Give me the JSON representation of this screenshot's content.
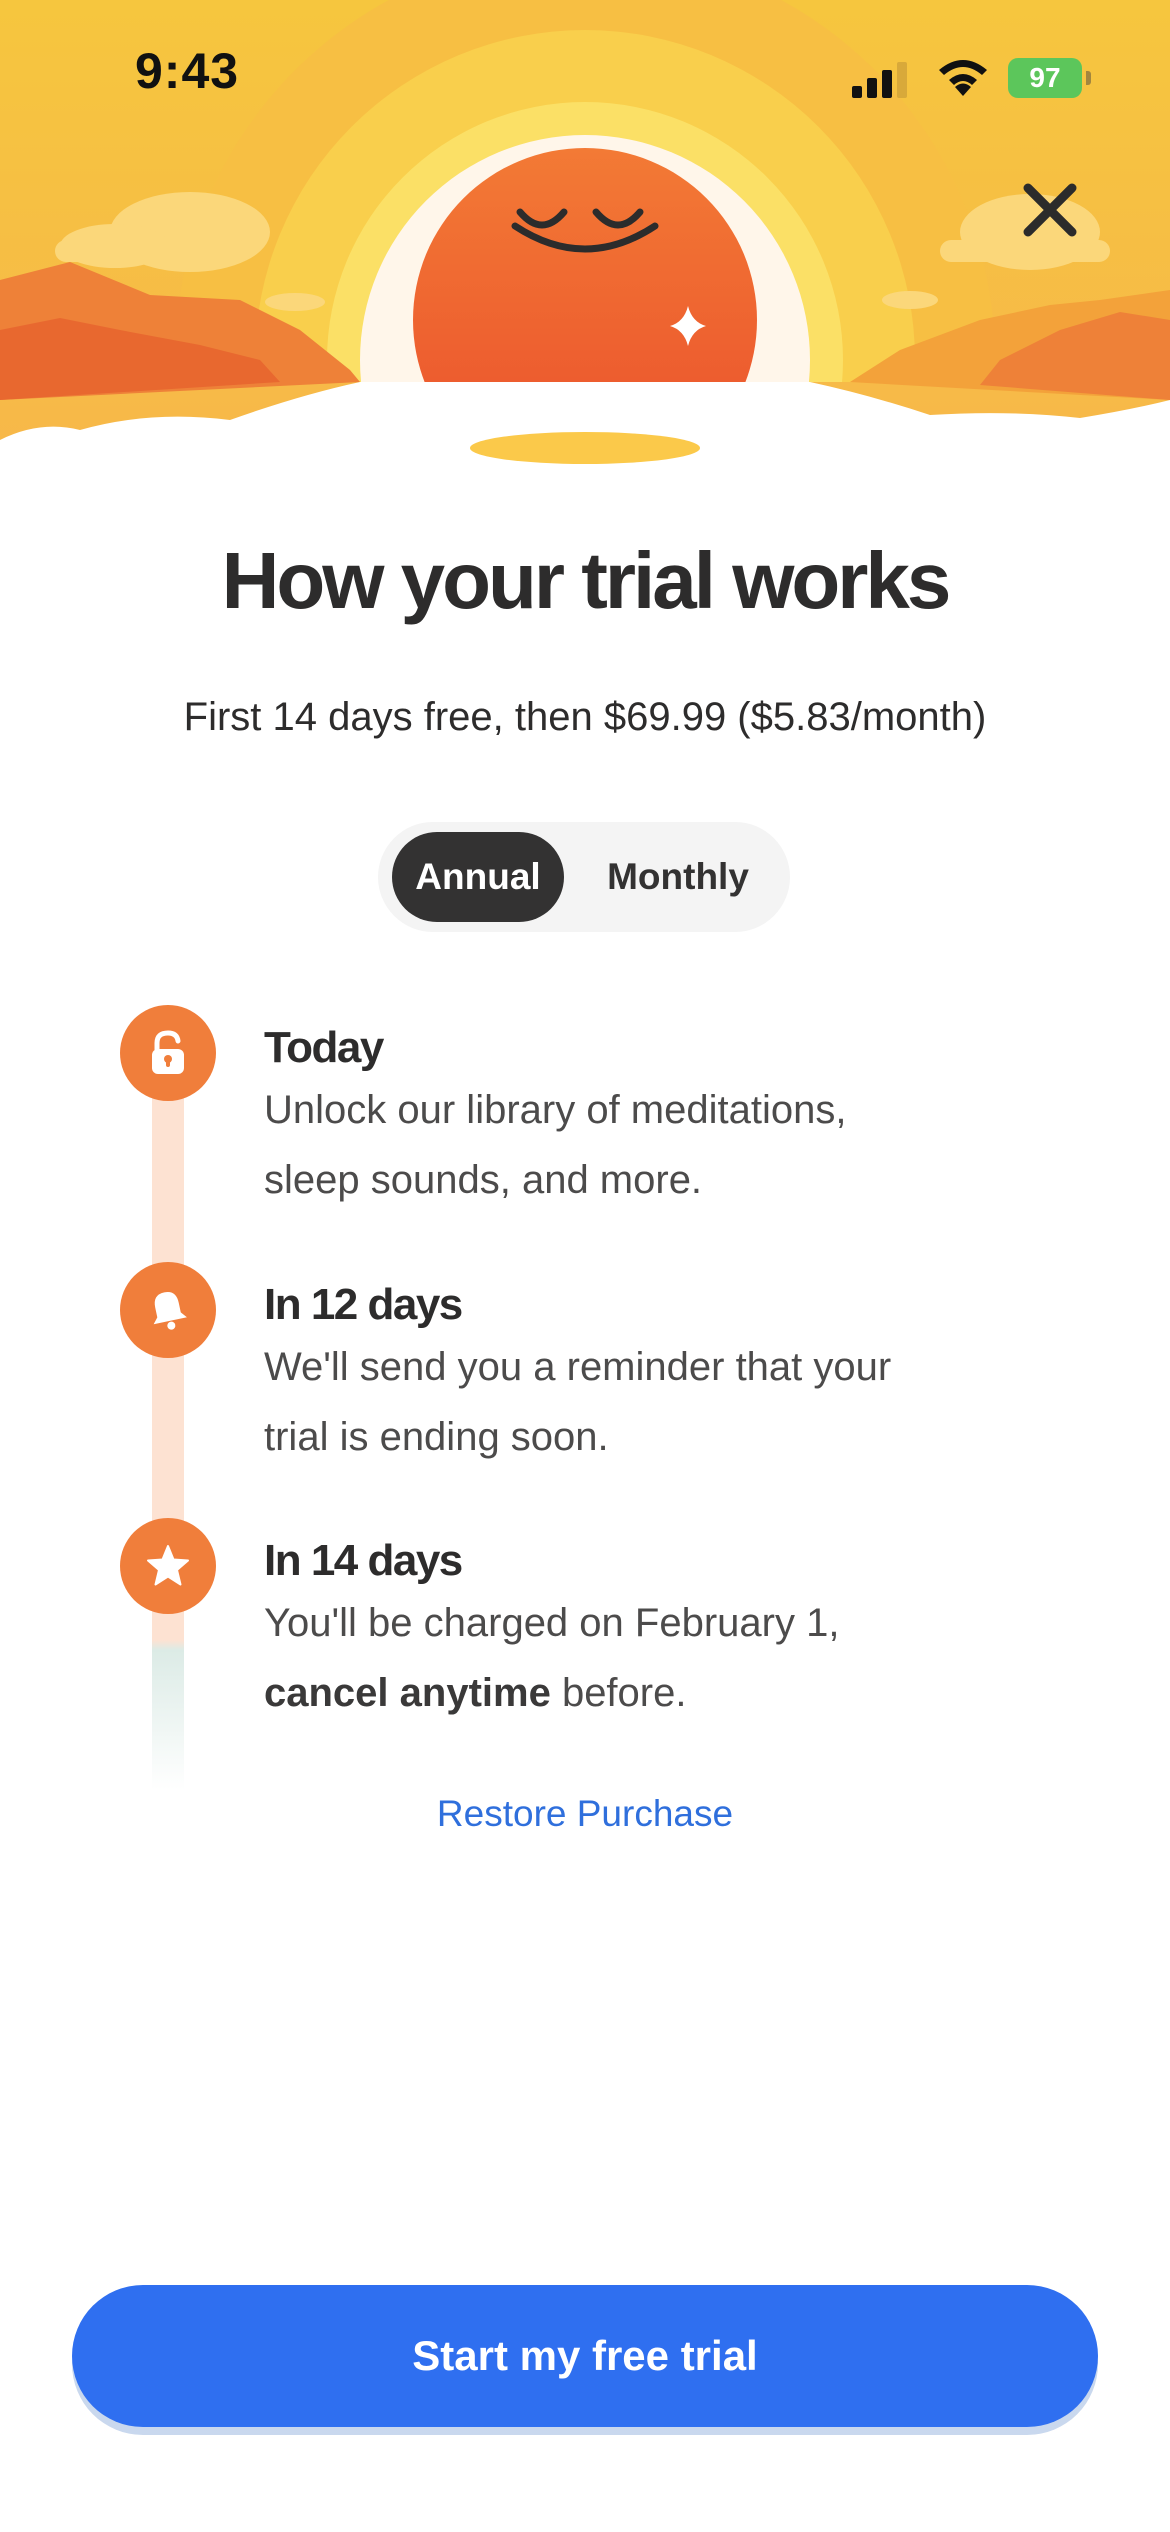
{
  "status_bar": {
    "time": "9:43",
    "battery": "97"
  },
  "header": {
    "title": "How your trial works",
    "price_summary": "First 14 days free, then $69.99 ($5.83/month)"
  },
  "billing_toggle": {
    "options": [
      "Annual",
      "Monthly"
    ],
    "selected": "Annual"
  },
  "timeline": [
    {
      "heading": "Today",
      "line1": "Unlock our library of meditations,",
      "line2": "sleep sounds, and more.",
      "icon": "unlock-icon"
    },
    {
      "heading": "In 12 days",
      "line1": "We'll send you a reminder that your",
      "line2": "trial is ending soon.",
      "icon": "bell-icon"
    },
    {
      "heading": "In 14 days",
      "line1": "You'll be charged on February 1,",
      "line2_bold": "cancel anytime",
      "line2_rest": " before.",
      "icon": "star-icon"
    }
  ],
  "restore_purchase": "Restore Purchase",
  "cta": {
    "label": "Start my free trial"
  },
  "colors": {
    "accent_orange": "#f07e3b",
    "cta_blue": "#2f6ff0",
    "link_blue": "#2f6fdc",
    "toggle_selected": "#333232",
    "hero_yellow": "#f6c244"
  }
}
